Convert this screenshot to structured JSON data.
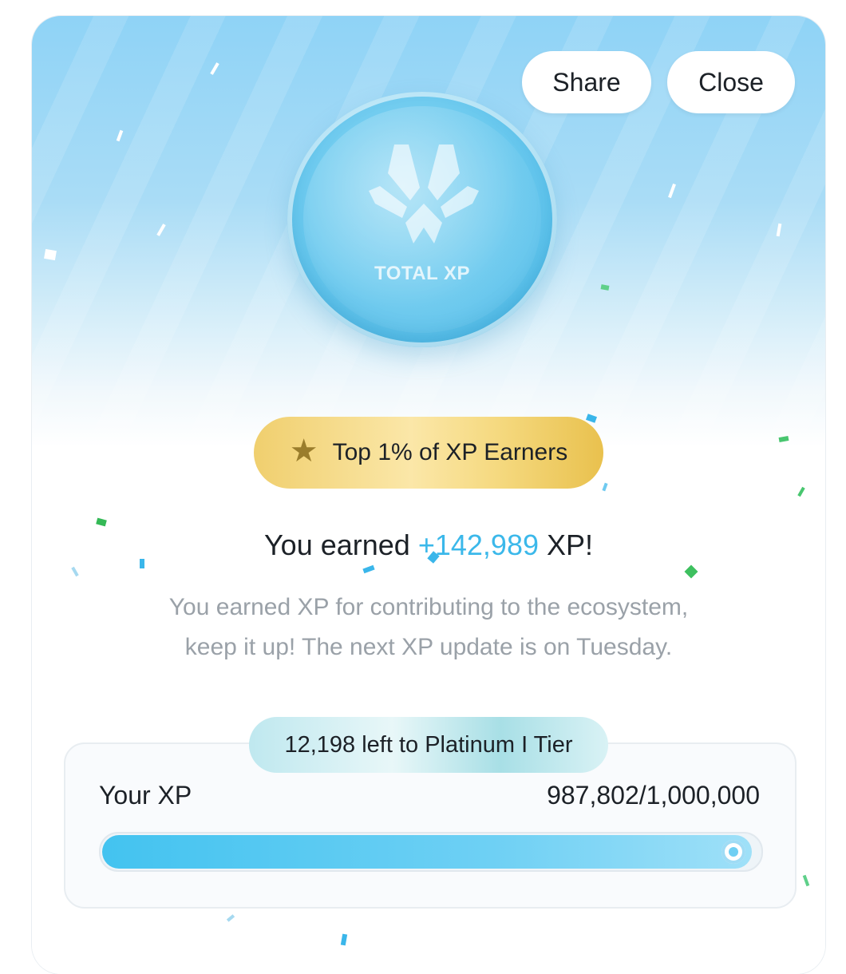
{
  "header": {
    "share_label": "Share",
    "close_label": "Close"
  },
  "coin": {
    "label": "TOTAL XP",
    "icon": "xp-logo-icon"
  },
  "badge": {
    "icon": "star-icon",
    "text": "Top 1% of XP Earners"
  },
  "earned": {
    "prefix": "You earned ",
    "amount": "+142,989",
    "suffix": " XP!"
  },
  "description": {
    "line1": "You earned XP for contributing to the ecosystem,",
    "line2": "keep it up! The next XP update is on Tuesday."
  },
  "progress": {
    "tier_text": "12,198 left to Platinum I Tier",
    "label": "Your XP",
    "value_text": "987,802/1,000,000",
    "current": 987802,
    "max": 1000000
  },
  "colors": {
    "accent": "#3bb8ea",
    "gold": "#f0cf6e",
    "text": "#1c2127",
    "muted": "#9aa1a8"
  }
}
